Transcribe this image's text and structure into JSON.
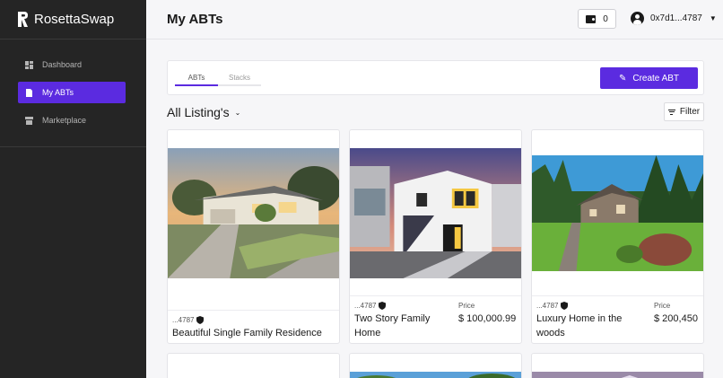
{
  "app": {
    "name": "RosettaSwap"
  },
  "sidebar": {
    "items": [
      {
        "label": "Dashboard",
        "icon": "dashboard-icon",
        "active": false
      },
      {
        "label": "My ABTs",
        "icon": "document-icon",
        "active": true
      },
      {
        "label": "Marketplace",
        "icon": "store-icon",
        "active": false
      }
    ]
  },
  "header": {
    "title": "My ABTs",
    "wallet_count": "0",
    "account": "0x7d1...4787"
  },
  "tabs": [
    {
      "label": "ABTs",
      "active": true
    },
    {
      "label": "Stacks",
      "active": false
    }
  ],
  "toolbar": {
    "create_label": "Create ABT"
  },
  "listing": {
    "heading": "All Listing's",
    "filter_label": "Filter"
  },
  "colors": {
    "accent": "#5b2be0",
    "sidebar_bg": "#252525"
  },
  "cards": [
    {
      "owner": "...4787",
      "title": "Beautiful Single Family Residence",
      "price_label": "",
      "price": ""
    },
    {
      "owner": "...4787",
      "title": "Two Story Family Home",
      "price_label": "Price",
      "price": "$ 100,000.99"
    },
    {
      "owner": "...4787",
      "title": "Luxury Home in the woods",
      "price_label": "Price",
      "price": "$ 200,450"
    }
  ]
}
